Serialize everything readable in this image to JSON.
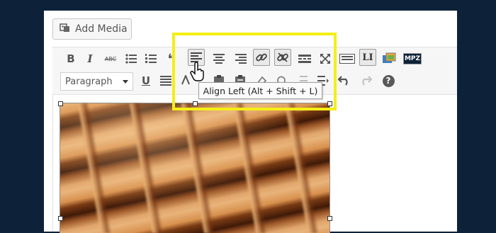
{
  "media": {
    "add_media_label": "Add Media"
  },
  "toolbar_row1": {
    "bold": "B",
    "italic": "I",
    "strikethrough": "ABC",
    "blockquote": "❝",
    "wordpress_label_li": "LI",
    "mpz_label": "MPZ"
  },
  "toolbar_row2": {
    "format_select_value": "Paragraph",
    "underline": "U",
    "help": "?"
  },
  "tooltip": {
    "text": "Align Left (Alt + Shift + L)"
  },
  "colors": {
    "page_background": "#0d2238",
    "highlight": "#f4ef14",
    "toolbar_bg": "#f6f6f6"
  }
}
